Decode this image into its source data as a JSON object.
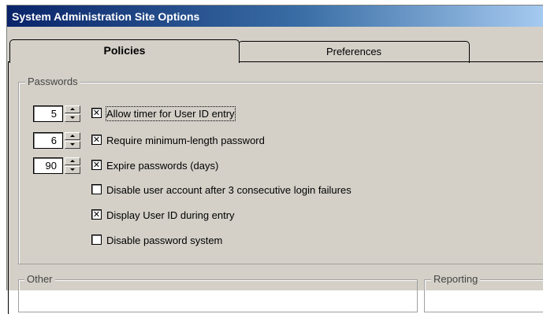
{
  "window": {
    "title": "System Administration Site Options"
  },
  "tabs": [
    {
      "label": "Policies",
      "selected": true
    },
    {
      "label": "Preferences",
      "selected": false
    }
  ],
  "passwords": {
    "legend": "Passwords",
    "spinners": [
      {
        "value": "5"
      },
      {
        "value": "6"
      },
      {
        "value": "90"
      }
    ],
    "options": [
      {
        "label": "Allow timer for User ID entry",
        "checked": true,
        "mark": "✕"
      },
      {
        "label": "Require minimum-length password",
        "checked": true,
        "mark": "✕"
      },
      {
        "label": "Expire passwords (days)",
        "checked": true,
        "mark": "✕"
      },
      {
        "label": "Disable user account after 3 consecutive login failures",
        "checked": false,
        "mark": ""
      },
      {
        "label": "Display User ID during entry",
        "checked": true,
        "mark": "✕"
      },
      {
        "label": "Disable password system",
        "checked": false,
        "mark": ""
      }
    ]
  },
  "other": {
    "legend": "Other"
  },
  "reporting": {
    "legend": "Reporting"
  },
  "icons": {
    "spin_up": "spin-up-arrow-icon",
    "spin_down": "spin-down-arrow-icon",
    "check": "checkmark-icon"
  }
}
